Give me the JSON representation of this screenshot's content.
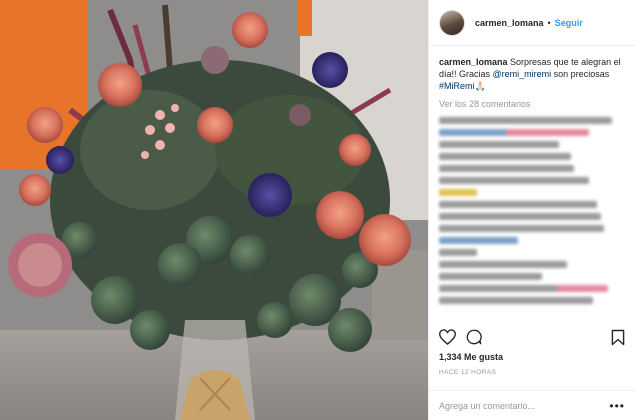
{
  "post": {
    "username": "carmen_lomana",
    "header_separator": "•",
    "follow_label": "Seguir",
    "caption": {
      "username": "carmen_lomana",
      "text_before": " Sorpresas que te alegran el día!! Gracias ",
      "mention": "@remi_miremi",
      "text_middle": " son preciosas ",
      "hashtag": "#MiRemi",
      "emoji": "🙏🏻"
    },
    "view_all_comments": "Ver los 28 comentarios",
    "likes": "1,334 Me gusta",
    "timestamp": "HACE 12 HORAS",
    "add_comment_placeholder": "Agrega un comentario...",
    "more_options": "•••"
  },
  "icons": {
    "like": "heart-icon",
    "comment": "comment-icon",
    "save": "bookmark-icon"
  },
  "colors": {
    "link": "#3897f0",
    "mention": "#003569",
    "wall_orange": "#e8742a"
  }
}
